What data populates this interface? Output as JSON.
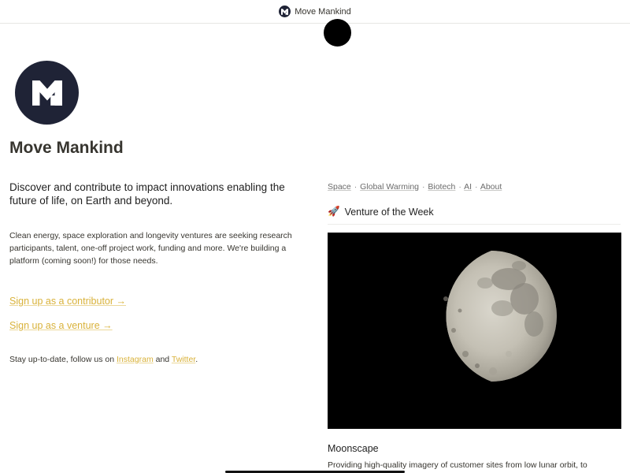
{
  "header": {
    "title": "Move Mankind",
    "logo_icon": "move-mankind-logo-icon"
  },
  "hero": {
    "title": "Move Mankind",
    "lead": "Discover and contribute to impact innovations enabling the future of life, on Earth and beyond.",
    "body": "Clean energy, space exploration and longevity ventures are seeking research participants, talent, one-off project work, funding and more. We're building a platform (coming soon!) for those needs.",
    "cta_contributor": "Sign up as a contributor →",
    "cta_venture": "Sign up as a venture →",
    "follow_prefix": "Stay up-to-date, follow us on ",
    "instagram": "Instagram",
    "follow_and": " and ",
    "twitter": "Twitter",
    "follow_suffix": "."
  },
  "nav": {
    "items": [
      "Space",
      "Global Warming",
      "Biotech",
      "AI",
      "About"
    ],
    "separator": "·"
  },
  "featured": {
    "section_emoji": "🚀",
    "section_title": "Venture of the Week",
    "image_icon": "moon-photo",
    "name": "Moonscape",
    "description": "Providing high-quality imagery of customer sites from low lunar orbit, to"
  },
  "colors": {
    "accent": "#d9b23a",
    "logo_bg": "#1f2336",
    "text": "#37352f"
  }
}
